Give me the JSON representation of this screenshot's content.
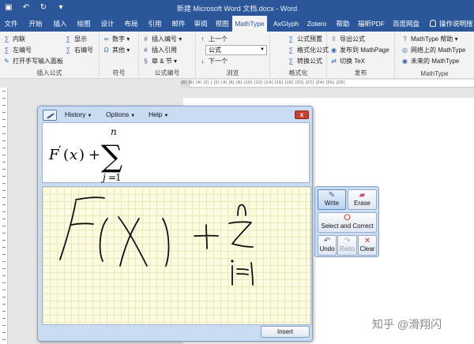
{
  "titlebar": {
    "title": "新建 Microsoft Word 文档.docx - Word",
    "qat": [
      "save-icon",
      "undo-icon",
      "redo-icon",
      "customize-icon"
    ]
  },
  "tabs": [
    "文件",
    "开始",
    "插入",
    "绘图",
    "设计",
    "布局",
    "引用",
    "邮件",
    "审阅",
    "视图",
    "MathType",
    "AxGlyph",
    "Zotero",
    "帮助",
    "福昕PDF",
    "百度网盘"
  ],
  "active_tab": "MathType",
  "tell_me": "操作说明搜",
  "ribbon": {
    "g1": {
      "label": "插入公式",
      "items": [
        "内联",
        "显示",
        "左编号",
        "右编号",
        "打开手写输入面板"
      ]
    },
    "g2": {
      "label": "符号",
      "items": [
        "数字",
        "其他"
      ]
    },
    "g3": {
      "label": "公式编号",
      "items": [
        "插入编号",
        "插入引用",
        "章 & 节"
      ]
    },
    "g4": {
      "label": "浏览",
      "items": [
        "上一个",
        "下一个"
      ],
      "select_value": "公式"
    },
    "g5": {
      "label": "格式化",
      "items": [
        "公式预置",
        "格式化公式",
        "转换公式"
      ]
    },
    "g6": {
      "label": "发布",
      "items": [
        "导出公式",
        "发布到 MathPage",
        "切换 TeX"
      ]
    },
    "g7": {
      "label": "MathType",
      "items": [
        "MathType 帮助",
        "网络上的 MathType",
        "未来的 MathType"
      ]
    }
  },
  "ruler_ticks": "|8| |6| |4| |2| | |2| |4| |6| |8| |10| |12| |14| |16| |18| |20| |22| |24| |26| |28|",
  "math_window": {
    "menus": [
      "History",
      "Options",
      "Help"
    ],
    "close_label": "x",
    "formula": {
      "func": "F",
      "prime": "′",
      "var": "x",
      "plus": "+",
      "sum": "∑",
      "upper": "n",
      "lower_var": "j",
      "eq": "=",
      "lower_val": "1"
    },
    "tools": {
      "write": "Write",
      "erase": "Erase",
      "select_correct": "Select and Correct",
      "undo": "Undo",
      "redo": "Redo",
      "clear": "Clear"
    },
    "insert": "Insert"
  },
  "watermark": "知乎 @滑翔闪"
}
